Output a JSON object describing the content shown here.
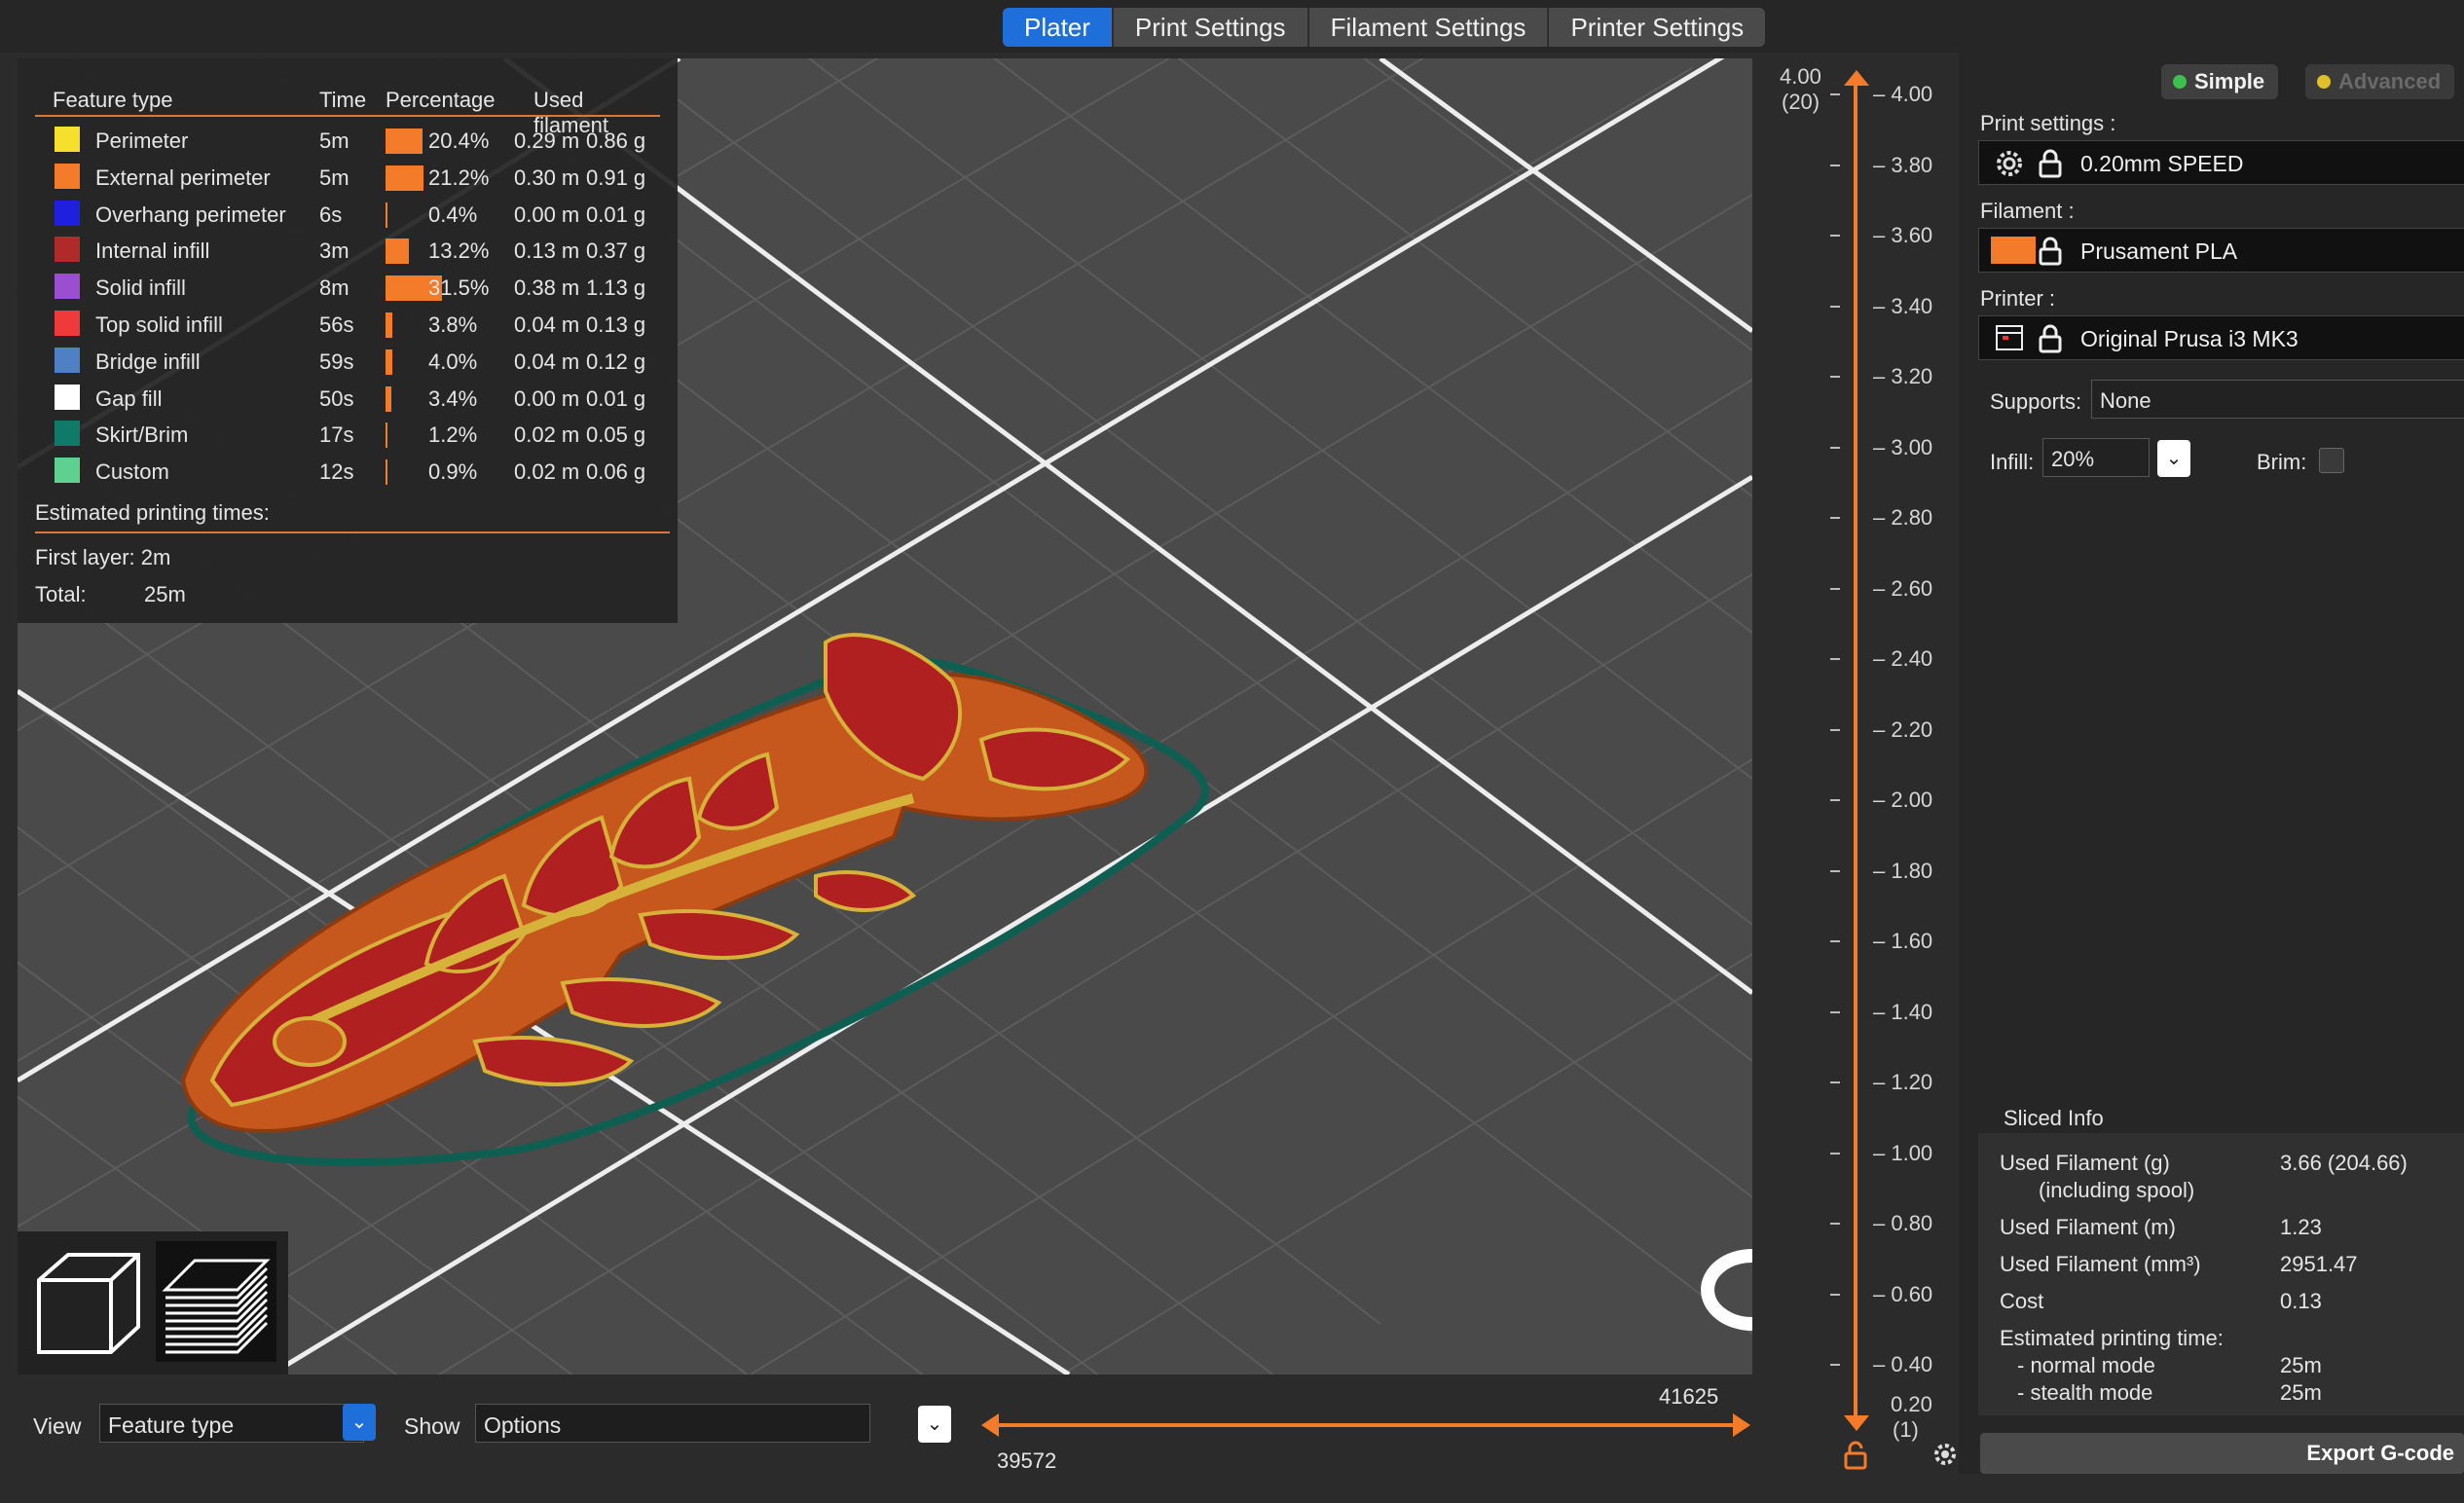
{
  "tabs": [
    "Plater",
    "Print Settings",
    "Filament Settings",
    "Printer Settings"
  ],
  "legend": {
    "headers": {
      "feature": "Feature type",
      "time": "Time",
      "percentage": "Percentage",
      "used": "Used filament"
    },
    "rows": [
      {
        "name": "Perimeter",
        "color": "#f5e12b",
        "time": "5m",
        "pct": "20.4%",
        "pct_value": 20.4,
        "m": "0.29 m",
        "g": "0.86 g"
      },
      {
        "name": "External perimeter",
        "color": "#f47b2a",
        "time": "5m",
        "pct": "21.2%",
        "pct_value": 21.2,
        "m": "0.30 m",
        "g": "0.91 g"
      },
      {
        "name": "Overhang perimeter",
        "color": "#1f1fe0",
        "time": "6s",
        "pct": "0.4%",
        "pct_value": 0.4,
        "m": "0.00 m",
        "g": "0.01 g"
      },
      {
        "name": "Internal infill",
        "color": "#b02a2a",
        "time": "3m",
        "pct": "13.2%",
        "pct_value": 13.2,
        "m": "0.13 m",
        "g": "0.37 g"
      },
      {
        "name": "Solid infill",
        "color": "#9b4fd0",
        "time": "8m",
        "pct": "31.5%",
        "pct_value": 31.5,
        "m": "0.38 m",
        "g": "1.13 g"
      },
      {
        "name": "Top solid infill",
        "color": "#f0393a",
        "time": "56s",
        "pct": "3.8%",
        "pct_value": 3.8,
        "m": "0.04 m",
        "g": "0.13 g"
      },
      {
        "name": "Bridge infill",
        "color": "#4f7fc4",
        "time": "59s",
        "pct": "4.0%",
        "pct_value": 4.0,
        "m": "0.04 m",
        "g": "0.12 g"
      },
      {
        "name": "Gap fill",
        "color": "#ffffff",
        "time": "50s",
        "pct": "3.4%",
        "pct_value": 3.4,
        "m": "0.00 m",
        "g": "0.01 g"
      },
      {
        "name": "Skirt/Brim",
        "color": "#0e7a67",
        "time": "17s",
        "pct": "1.2%",
        "pct_value": 1.2,
        "m": "0.02 m",
        "g": "0.05 g"
      },
      {
        "name": "Custom",
        "color": "#5ed08f",
        "time": "12s",
        "pct": "0.9%",
        "pct_value": 0.9,
        "m": "0.02 m",
        "g": "0.06 g"
      }
    ],
    "estimated_label": "Estimated printing times:",
    "first_layer": "First layer: 2m",
    "total_label": "Total:",
    "total_value": "25m"
  },
  "bottom": {
    "view_label": "View",
    "view_value": "Feature type",
    "show_label": "Show",
    "show_value": "Options",
    "hslider_low": "39572",
    "hslider_high": "41625"
  },
  "vslider": {
    "top_value": "4.00",
    "top_layer": "(20)",
    "bottom_value": "0.20",
    "bottom_layer": "(1)",
    "ticks": [
      "4.00",
      "3.80",
      "3.60",
      "3.40",
      "3.20",
      "3.00",
      "2.80",
      "2.60",
      "2.40",
      "2.20",
      "2.00",
      "1.80",
      "1.60",
      "1.40",
      "1.20",
      "1.00",
      "0.80",
      "0.60",
      "0.40"
    ]
  },
  "right": {
    "mode_simple": "Simple",
    "mode_advanced": "Advanced",
    "print_settings_label": "Print settings :",
    "print_settings_value": "0.20mm SPEED",
    "filament_label": "Filament :",
    "filament_value": "Prusament PLA",
    "filament_color": "#f47b2a",
    "printer_label": "Printer :",
    "printer_value": "Original Prusa i3 MK3",
    "supports_label": "Supports:",
    "supports_value": "None",
    "infill_label": "Infill:",
    "infill_value": "20%",
    "brim_label": "Brim:",
    "sliced_info_title": "Sliced Info",
    "used_g_label": "Used Filament (g)",
    "used_g_sub": "(including spool)",
    "used_g_value": "3.66 (204.66)",
    "used_m_label": "Used Filament (m)",
    "used_m_value": "1.23",
    "used_mm3_label": "Used Filament (mm³)",
    "used_mm3_value": "2951.47",
    "cost_label": "Cost",
    "cost_value": "0.13",
    "est_time_label": "Estimated printing time:",
    "normal_label": "- normal mode",
    "normal_value": "25m",
    "stealth_label": "- stealth mode",
    "stealth_value": "25m",
    "export_label": "Export G-code"
  }
}
